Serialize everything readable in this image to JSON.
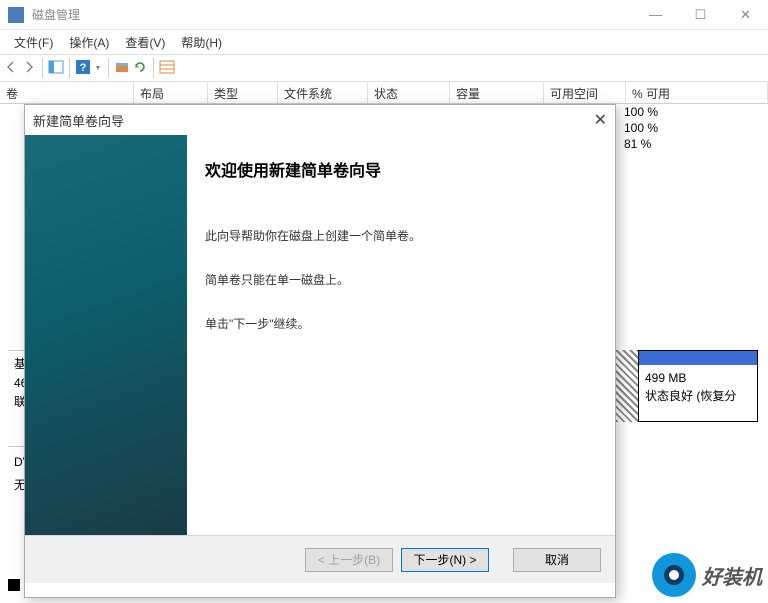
{
  "app": {
    "title": "磁盘管理"
  },
  "window_controls": {
    "min": "—",
    "max": "☐",
    "close": "✕"
  },
  "menubar": {
    "file": "文件(F)",
    "action": "操作(A)",
    "view": "查看(V)",
    "help": "帮助(H)"
  },
  "columns": {
    "volume": "卷",
    "layout": "布局",
    "type": "类型",
    "filesystem": "文件系统",
    "status": "状态",
    "capacity": "容量",
    "free": "可用空间",
    "pct": "% 可用"
  },
  "pct_rows": [
    "100 %",
    "100 %",
    "81 %"
  ],
  "disk_info": {
    "l1": "基",
    "l2": "46",
    "l3": "联"
  },
  "disk_info2": {
    "l1": "DV",
    "l2": "无"
  },
  "partition": {
    "size": "499 MB",
    "status": "状态良好 (恢复分"
  },
  "wizard": {
    "title": "新建简单卷向导",
    "heading": "欢迎使用新建简单卷向导",
    "p1": "此向导帮助你在磁盘上创建一个简单卷。",
    "p2": "简单卷只能在单一磁盘上。",
    "p3": "单击\"下一步\"继续。",
    "back": "< 上一步(B)",
    "next": "下一步(N) >",
    "cancel": "取消"
  },
  "watermark": {
    "text": "好装机"
  }
}
